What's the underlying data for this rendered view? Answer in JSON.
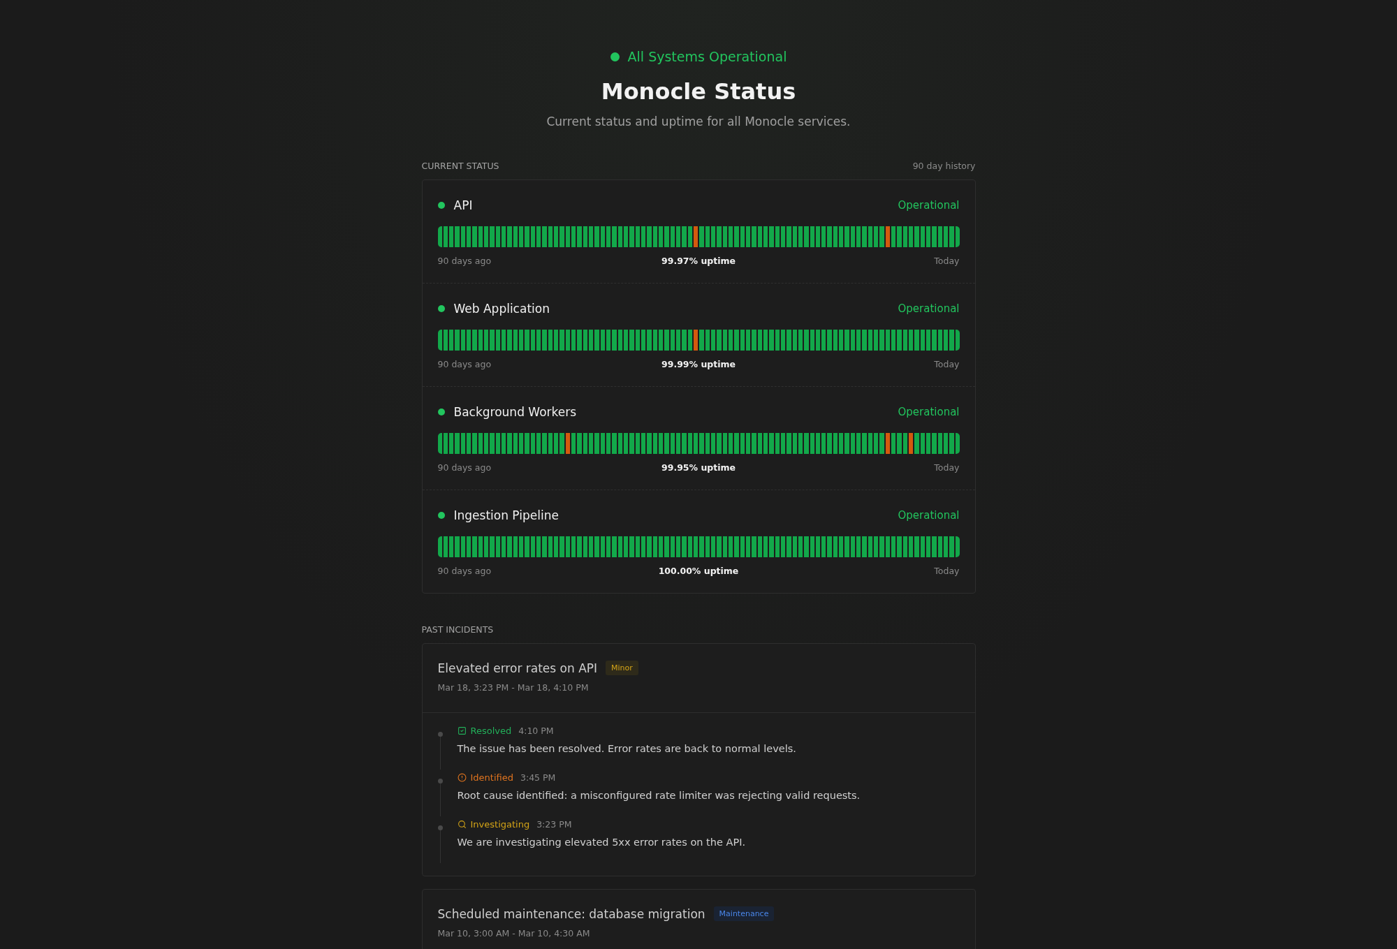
{
  "banner": {
    "label": "All Systems Operational",
    "kind": "operational"
  },
  "title": "Monocle Status",
  "subtitle": "Current status and uptime for all Monocle services.",
  "current_status": {
    "heading": "CURRENT STATUS",
    "range_label": "90 day history",
    "services": [
      {
        "name": "API",
        "kind": "operational",
        "status_label": "Operational",
        "start_label": "90 days ago",
        "uptime": "99.97% uptime",
        "end_label": "Today",
        "history": [
          {
            "outage": false
          },
          {
            "outage": false
          },
          {
            "outage": false
          },
          {
            "outage": false
          },
          {
            "outage": false
          },
          {
            "outage": false
          },
          {
            "outage": false
          },
          {
            "outage": false
          },
          {
            "outage": false
          },
          {
            "outage": false
          },
          {
            "outage": false
          },
          {
            "outage": false
          },
          {
            "outage": false
          },
          {
            "outage": false
          },
          {
            "outage": false
          },
          {
            "outage": false
          },
          {
            "outage": false
          },
          {
            "outage": false
          },
          {
            "outage": false
          },
          {
            "outage": false
          },
          {
            "outage": false
          },
          {
            "outage": false
          },
          {
            "outage": false
          },
          {
            "outage": false
          },
          {
            "outage": false
          },
          {
            "outage": false
          },
          {
            "outage": false
          },
          {
            "outage": false
          },
          {
            "outage": false
          },
          {
            "outage": false
          },
          {
            "outage": false
          },
          {
            "outage": false
          },
          {
            "outage": false
          },
          {
            "outage": false
          },
          {
            "outage": false
          },
          {
            "outage": false
          },
          {
            "outage": false
          },
          {
            "outage": false
          },
          {
            "outage": false
          },
          {
            "outage": false
          },
          {
            "outage": false
          },
          {
            "outage": false
          },
          {
            "outage": false
          },
          {
            "outage": false
          },
          {
            "outage": true
          },
          {
            "outage": false
          },
          {
            "outage": false
          },
          {
            "outage": false
          },
          {
            "outage": false
          },
          {
            "outage": false
          },
          {
            "outage": false
          },
          {
            "outage": false
          },
          {
            "outage": false
          },
          {
            "outage": false
          },
          {
            "outage": false
          },
          {
            "outage": false
          },
          {
            "outage": false
          },
          {
            "outage": false
          },
          {
            "outage": false
          },
          {
            "outage": false
          },
          {
            "outage": false
          },
          {
            "outage": false
          },
          {
            "outage": false
          },
          {
            "outage": false
          },
          {
            "outage": false
          },
          {
            "outage": false
          },
          {
            "outage": false
          },
          {
            "outage": false
          },
          {
            "outage": false
          },
          {
            "outage": false
          },
          {
            "outage": false
          },
          {
            "outage": false
          },
          {
            "outage": false
          },
          {
            "outage": false
          },
          {
            "outage": false
          },
          {
            "outage": false
          },
          {
            "outage": false
          },
          {
            "outage": true
          },
          {
            "outage": false
          },
          {
            "outage": false
          },
          {
            "outage": false
          },
          {
            "outage": false
          },
          {
            "outage": false
          },
          {
            "outage": false
          },
          {
            "outage": false
          },
          {
            "outage": false
          },
          {
            "outage": false
          },
          {
            "outage": false
          },
          {
            "outage": false
          },
          {
            "outage": false
          }
        ]
      },
      {
        "name": "Web Application",
        "kind": "operational",
        "status_label": "Operational",
        "start_label": "90 days ago",
        "uptime": "99.99% uptime",
        "end_label": "Today",
        "history": [
          {
            "outage": false
          },
          {
            "outage": false
          },
          {
            "outage": false
          },
          {
            "outage": false
          },
          {
            "outage": false
          },
          {
            "outage": false
          },
          {
            "outage": false
          },
          {
            "outage": false
          },
          {
            "outage": false
          },
          {
            "outage": false
          },
          {
            "outage": false
          },
          {
            "outage": false
          },
          {
            "outage": false
          },
          {
            "outage": false
          },
          {
            "outage": false
          },
          {
            "outage": false
          },
          {
            "outage": false
          },
          {
            "outage": false
          },
          {
            "outage": false
          },
          {
            "outage": false
          },
          {
            "outage": false
          },
          {
            "outage": false
          },
          {
            "outage": false
          },
          {
            "outage": false
          },
          {
            "outage": false
          },
          {
            "outage": false
          },
          {
            "outage": false
          },
          {
            "outage": false
          },
          {
            "outage": false
          },
          {
            "outage": false
          },
          {
            "outage": false
          },
          {
            "outage": false
          },
          {
            "outage": false
          },
          {
            "outage": false
          },
          {
            "outage": false
          },
          {
            "outage": false
          },
          {
            "outage": false
          },
          {
            "outage": false
          },
          {
            "outage": false
          },
          {
            "outage": false
          },
          {
            "outage": false
          },
          {
            "outage": false
          },
          {
            "outage": false
          },
          {
            "outage": false
          },
          {
            "outage": true
          },
          {
            "outage": false
          },
          {
            "outage": false
          },
          {
            "outage": false
          },
          {
            "outage": false
          },
          {
            "outage": false
          },
          {
            "outage": false
          },
          {
            "outage": false
          },
          {
            "outage": false
          },
          {
            "outage": false
          },
          {
            "outage": false
          },
          {
            "outage": false
          },
          {
            "outage": false
          },
          {
            "outage": false
          },
          {
            "outage": false
          },
          {
            "outage": false
          },
          {
            "outage": false
          },
          {
            "outage": false
          },
          {
            "outage": false
          },
          {
            "outage": false
          },
          {
            "outage": false
          },
          {
            "outage": false
          },
          {
            "outage": false
          },
          {
            "outage": false
          },
          {
            "outage": false
          },
          {
            "outage": false
          },
          {
            "outage": false
          },
          {
            "outage": false
          },
          {
            "outage": false
          },
          {
            "outage": false
          },
          {
            "outage": false
          },
          {
            "outage": false
          },
          {
            "outage": false
          },
          {
            "outage": false
          },
          {
            "outage": false
          },
          {
            "outage": false
          },
          {
            "outage": false
          },
          {
            "outage": false
          },
          {
            "outage": false
          },
          {
            "outage": false
          },
          {
            "outage": false
          },
          {
            "outage": false
          },
          {
            "outage": false
          },
          {
            "outage": false
          },
          {
            "outage": false
          },
          {
            "outage": false
          }
        ]
      },
      {
        "name": "Background Workers",
        "kind": "operational",
        "status_label": "Operational",
        "start_label": "90 days ago",
        "uptime": "99.95% uptime",
        "end_label": "Today",
        "history": [
          {
            "outage": false
          },
          {
            "outage": false
          },
          {
            "outage": false
          },
          {
            "outage": false
          },
          {
            "outage": false
          },
          {
            "outage": false
          },
          {
            "outage": false
          },
          {
            "outage": false
          },
          {
            "outage": false
          },
          {
            "outage": false
          },
          {
            "outage": false
          },
          {
            "outage": false
          },
          {
            "outage": false
          },
          {
            "outage": false
          },
          {
            "outage": false
          },
          {
            "outage": false
          },
          {
            "outage": false
          },
          {
            "outage": false
          },
          {
            "outage": false
          },
          {
            "outage": false
          },
          {
            "outage": false
          },
          {
            "outage": false
          },
          {
            "outage": true
          },
          {
            "outage": false
          },
          {
            "outage": false
          },
          {
            "outage": false
          },
          {
            "outage": false
          },
          {
            "outage": false
          },
          {
            "outage": false
          },
          {
            "outage": false
          },
          {
            "outage": false
          },
          {
            "outage": false
          },
          {
            "outage": false
          },
          {
            "outage": false
          },
          {
            "outage": false
          },
          {
            "outage": false
          },
          {
            "outage": false
          },
          {
            "outage": false
          },
          {
            "outage": false
          },
          {
            "outage": false
          },
          {
            "outage": false
          },
          {
            "outage": false
          },
          {
            "outage": false
          },
          {
            "outage": false
          },
          {
            "outage": false
          },
          {
            "outage": false
          },
          {
            "outage": false
          },
          {
            "outage": false
          },
          {
            "outage": false
          },
          {
            "outage": false
          },
          {
            "outage": false
          },
          {
            "outage": false
          },
          {
            "outage": false
          },
          {
            "outage": false
          },
          {
            "outage": false
          },
          {
            "outage": false
          },
          {
            "outage": false
          },
          {
            "outage": false
          },
          {
            "outage": false
          },
          {
            "outage": false
          },
          {
            "outage": false
          },
          {
            "outage": false
          },
          {
            "outage": false
          },
          {
            "outage": false
          },
          {
            "outage": false
          },
          {
            "outage": false
          },
          {
            "outage": false
          },
          {
            "outage": false
          },
          {
            "outage": false
          },
          {
            "outage": false
          },
          {
            "outage": false
          },
          {
            "outage": false
          },
          {
            "outage": false
          },
          {
            "outage": false
          },
          {
            "outage": false
          },
          {
            "outage": false
          },
          {
            "outage": false
          },
          {
            "outage": true
          },
          {
            "outage": false
          },
          {
            "outage": false
          },
          {
            "outage": false
          },
          {
            "outage": true
          },
          {
            "outage": false
          },
          {
            "outage": false
          },
          {
            "outage": false
          },
          {
            "outage": false
          },
          {
            "outage": false
          },
          {
            "outage": false
          },
          {
            "outage": false
          },
          {
            "outage": false
          }
        ]
      },
      {
        "name": "Ingestion Pipeline",
        "kind": "operational",
        "status_label": "Operational",
        "start_label": "90 days ago",
        "uptime": "100.00% uptime",
        "end_label": "Today",
        "history": [
          {
            "outage": false
          },
          {
            "outage": false
          },
          {
            "outage": false
          },
          {
            "outage": false
          },
          {
            "outage": false
          },
          {
            "outage": false
          },
          {
            "outage": false
          },
          {
            "outage": false
          },
          {
            "outage": false
          },
          {
            "outage": false
          },
          {
            "outage": false
          },
          {
            "outage": false
          },
          {
            "outage": false
          },
          {
            "outage": false
          },
          {
            "outage": false
          },
          {
            "outage": false
          },
          {
            "outage": false
          },
          {
            "outage": false
          },
          {
            "outage": false
          },
          {
            "outage": false
          },
          {
            "outage": false
          },
          {
            "outage": false
          },
          {
            "outage": false
          },
          {
            "outage": false
          },
          {
            "outage": false
          },
          {
            "outage": false
          },
          {
            "outage": false
          },
          {
            "outage": false
          },
          {
            "outage": false
          },
          {
            "outage": false
          },
          {
            "outage": false
          },
          {
            "outage": false
          },
          {
            "outage": false
          },
          {
            "outage": false
          },
          {
            "outage": false
          },
          {
            "outage": false
          },
          {
            "outage": false
          },
          {
            "outage": false
          },
          {
            "outage": false
          },
          {
            "outage": false
          },
          {
            "outage": false
          },
          {
            "outage": false
          },
          {
            "outage": false
          },
          {
            "outage": false
          },
          {
            "outage": false
          },
          {
            "outage": false
          },
          {
            "outage": false
          },
          {
            "outage": false
          },
          {
            "outage": false
          },
          {
            "outage": false
          },
          {
            "outage": false
          },
          {
            "outage": false
          },
          {
            "outage": false
          },
          {
            "outage": false
          },
          {
            "outage": false
          },
          {
            "outage": false
          },
          {
            "outage": false
          },
          {
            "outage": false
          },
          {
            "outage": false
          },
          {
            "outage": false
          },
          {
            "outage": false
          },
          {
            "outage": false
          },
          {
            "outage": false
          },
          {
            "outage": false
          },
          {
            "outage": false
          },
          {
            "outage": false
          },
          {
            "outage": false
          },
          {
            "outage": false
          },
          {
            "outage": false
          },
          {
            "outage": false
          },
          {
            "outage": false
          },
          {
            "outage": false
          },
          {
            "outage": false
          },
          {
            "outage": false
          },
          {
            "outage": false
          },
          {
            "outage": false
          },
          {
            "outage": false
          },
          {
            "outage": false
          },
          {
            "outage": false
          },
          {
            "outage": false
          },
          {
            "outage": false
          },
          {
            "outage": false
          },
          {
            "outage": false
          },
          {
            "outage": false
          },
          {
            "outage": false
          },
          {
            "outage": false
          },
          {
            "outage": false
          },
          {
            "outage": false
          },
          {
            "outage": false
          },
          {
            "outage": false
          }
        ]
      }
    ]
  },
  "past_incidents": {
    "heading": "PAST INCIDENTS",
    "incidents": [
      {
        "title": "Elevated error rates on API",
        "badge": "Minor",
        "kind": "minor",
        "period": "Mar 18, 3:23 PM - Mar 18, 4:10 PM",
        "updates": [
          {
            "kind": "resolved",
            "label": "Resolved",
            "time": "4:10 PM",
            "message": "The issue has been resolved. Error rates are back to normal levels."
          },
          {
            "kind": "identified",
            "label": "Identified",
            "time": "3:45 PM",
            "message": "Root cause identified: a misconfigured rate limiter was rejecting valid requests."
          },
          {
            "kind": "investigating",
            "label": "Investigating",
            "time": "3:23 PM",
            "message": "We are investigating elevated 5xx error rates on the API."
          }
        ]
      },
      {
        "title": "Scheduled maintenance: database migration",
        "badge": "Maintenance",
        "kind": "maintenance",
        "period": "Mar 10, 3:00 AM - Mar 10, 4:30 AM"
      }
    ]
  }
}
